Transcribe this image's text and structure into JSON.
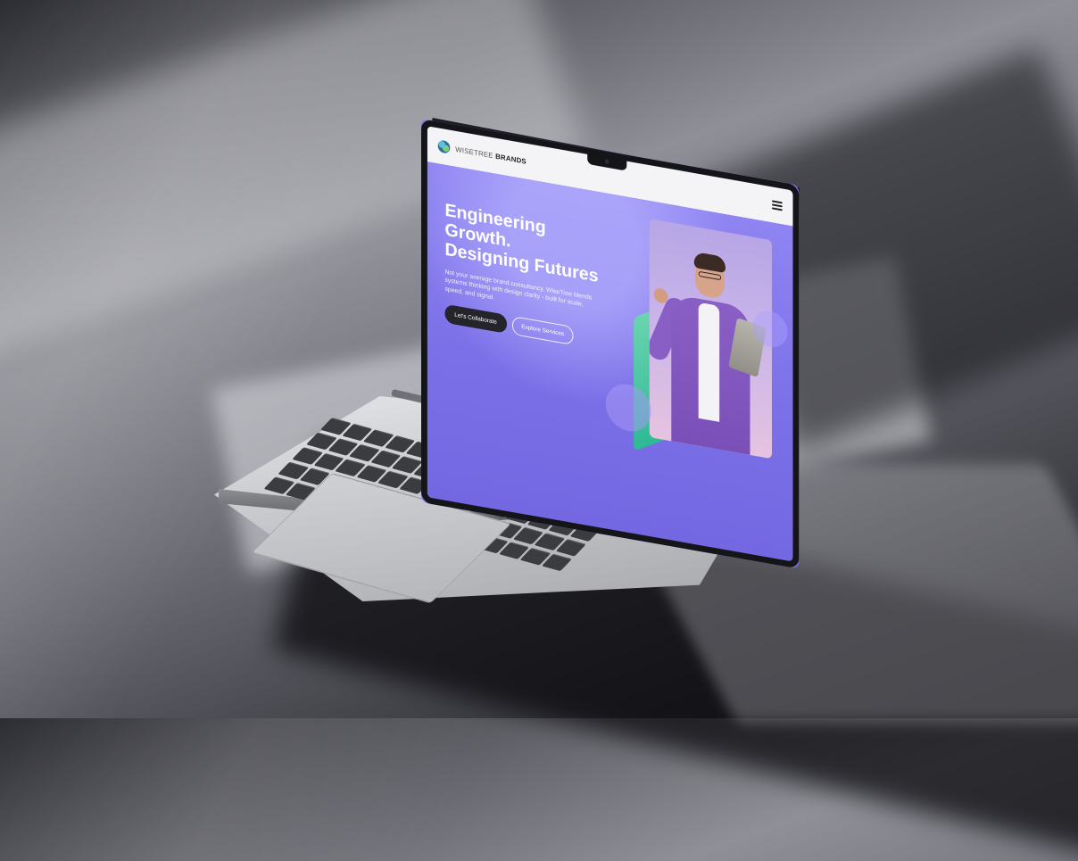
{
  "site": {
    "logo": {
      "text_light": "WISETREE",
      "text_bold": "BRANDS"
    }
  },
  "hero": {
    "title_line_1": "Engineering Growth.",
    "title_line_2": "Designing Futures",
    "subtitle": "Not your average brand consultancy. WiseTree blends systems thinking with design clarity - built for scale, speed, and signal.",
    "primary_cta": "Let's Collaborate",
    "secondary_cta": "Explore Services"
  },
  "colors": {
    "hero_background": "#7c70e8",
    "header_background": "#f4f4f6",
    "primary_button": "#24242a",
    "accent_green": "#2eb995"
  },
  "icons": {
    "logo_mark": "tree-logo-icon",
    "menu": "hamburger-menu-icon"
  }
}
